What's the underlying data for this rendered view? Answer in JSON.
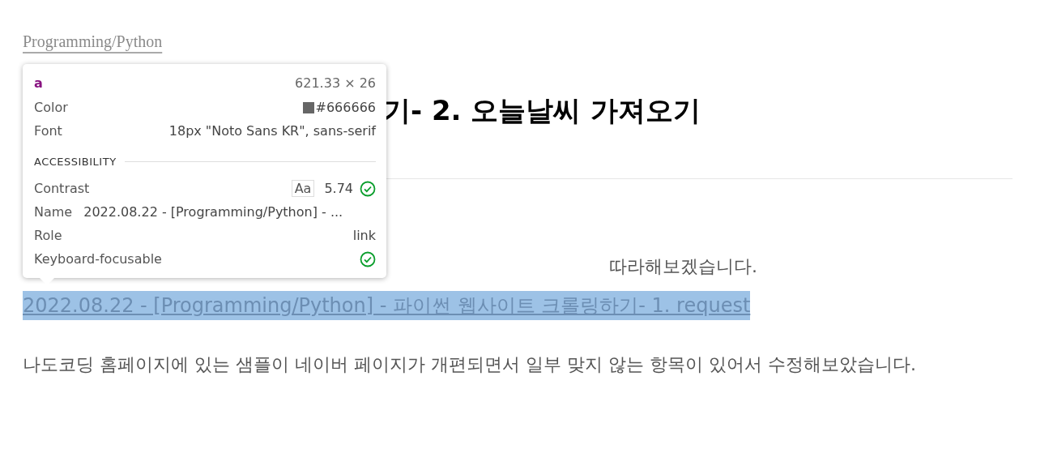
{
  "category": "Programming/Python",
  "title_visible": "기- 2. 오늘날씨 가져오기",
  "intro_visible": "따라해보겠습니다.",
  "link": {
    "text": "2022.08.22 - [Programming/Python] - 파이썬 웹사이트 크롤링하기- 1. request",
    "selected": true
  },
  "paragraph": "나도코딩 홈페이지에 있는 샘플이 네이버 페이지가 개편되면서 일부 맞지 않는 항목이 있어서 수정해보았습니다.",
  "tooltip": {
    "tag": "a",
    "size": "621.33 × 26",
    "rows": [
      {
        "kind": "swatch",
        "label": "Color",
        "value": "#666666",
        "color": "#666666"
      },
      {
        "kind": "text",
        "label": "Font",
        "value": "18px \"Noto Sans KR\", sans-serif"
      },
      {
        "kind": "section",
        "label": "ACCESSIBILITY"
      },
      {
        "kind": "contrast",
        "label": "Contrast",
        "sample": "Aa",
        "value": "5.74",
        "pass": true
      },
      {
        "kind": "name",
        "label": "Name",
        "value": "2022.08.22 - [Programming/Python] - ..."
      },
      {
        "kind": "text",
        "label": "Role",
        "value": "link"
      },
      {
        "kind": "check",
        "label": "Keyboard-focusable",
        "pass": true
      }
    ]
  }
}
